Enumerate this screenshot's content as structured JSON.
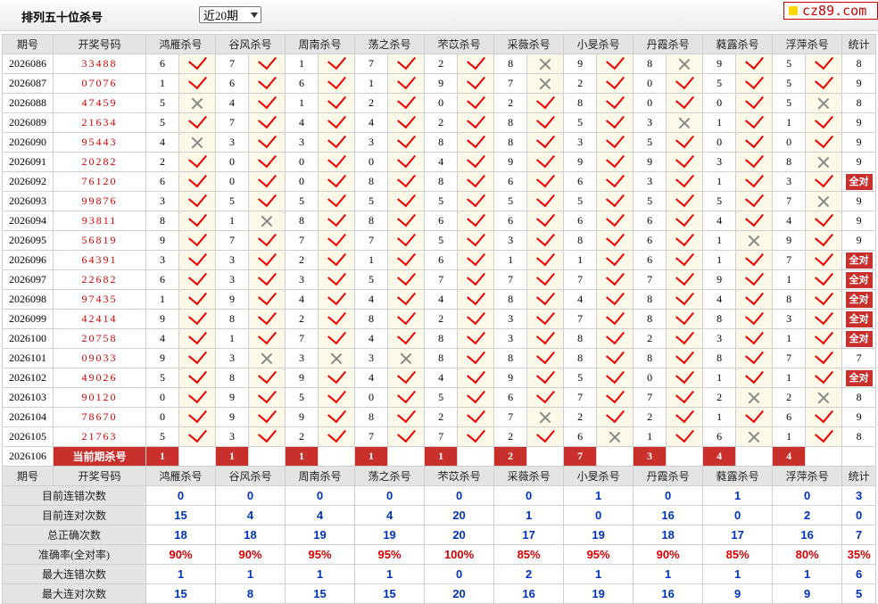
{
  "header": {
    "title": "排列五十位杀号",
    "select_value": "近20期",
    "logo": "cz89.com"
  },
  "table": {
    "columns": [
      "期号",
      "开奖号码",
      "鸿雁杀号",
      "谷风杀号",
      "周南杀号",
      "荡之杀号",
      "芣苡杀号",
      "采薇杀号",
      "小旻杀号",
      "丹霞杀号",
      "蕤露杀号",
      "浮萍杀号",
      "统计"
    ],
    "all_correct_label": "全对",
    "rows": [
      {
        "p": "2026086",
        "d": "33488",
        "k": [
          [
            6,
            1
          ],
          [
            7,
            1
          ],
          [
            1,
            1
          ],
          [
            7,
            1
          ],
          [
            2,
            1
          ],
          [
            8,
            0
          ],
          [
            9,
            1
          ],
          [
            8,
            0
          ],
          [
            9,
            1
          ],
          [
            5,
            1
          ]
        ],
        "s": "8"
      },
      {
        "p": "2026087",
        "d": "07076",
        "k": [
          [
            1,
            1
          ],
          [
            6,
            1
          ],
          [
            6,
            1
          ],
          [
            1,
            1
          ],
          [
            9,
            1
          ],
          [
            7,
            0
          ],
          [
            2,
            1
          ],
          [
            0,
            1
          ],
          [
            5,
            1
          ],
          [
            5,
            1
          ]
        ],
        "s": "9"
      },
      {
        "p": "2026088",
        "d": "47459",
        "k": [
          [
            5,
            0
          ],
          [
            4,
            1
          ],
          [
            1,
            1
          ],
          [
            2,
            1
          ],
          [
            0,
            1
          ],
          [
            2,
            1
          ],
          [
            8,
            1
          ],
          [
            0,
            1
          ],
          [
            0,
            1
          ],
          [
            5,
            0
          ]
        ],
        "s": "8"
      },
      {
        "p": "2026089",
        "d": "21634",
        "k": [
          [
            5,
            1
          ],
          [
            7,
            1
          ],
          [
            4,
            1
          ],
          [
            4,
            1
          ],
          [
            2,
            1
          ],
          [
            8,
            1
          ],
          [
            5,
            1
          ],
          [
            3,
            0
          ],
          [
            1,
            1
          ],
          [
            1,
            1
          ]
        ],
        "s": "9"
      },
      {
        "p": "2026090",
        "d": "95443",
        "k": [
          [
            4,
            0
          ],
          [
            3,
            1
          ],
          [
            3,
            1
          ],
          [
            3,
            1
          ],
          [
            8,
            1
          ],
          [
            8,
            1
          ],
          [
            3,
            1
          ],
          [
            5,
            1
          ],
          [
            0,
            1
          ],
          [
            0,
            1
          ]
        ],
        "s": "9"
      },
      {
        "p": "2026091",
        "d": "20282",
        "k": [
          [
            2,
            1
          ],
          [
            0,
            1
          ],
          [
            0,
            1
          ],
          [
            0,
            1
          ],
          [
            4,
            1
          ],
          [
            9,
            1
          ],
          [
            9,
            1
          ],
          [
            9,
            1
          ],
          [
            3,
            1
          ],
          [
            8,
            0
          ]
        ],
        "s": "9"
      },
      {
        "p": "2026092",
        "d": "76120",
        "k": [
          [
            6,
            1
          ],
          [
            0,
            1
          ],
          [
            0,
            1
          ],
          [
            8,
            1
          ],
          [
            8,
            1
          ],
          [
            6,
            1
          ],
          [
            6,
            1
          ],
          [
            3,
            1
          ],
          [
            1,
            1
          ],
          [
            3,
            1
          ]
        ],
        "s": "全对"
      },
      {
        "p": "2026093",
        "d": "99876",
        "k": [
          [
            3,
            1
          ],
          [
            5,
            1
          ],
          [
            5,
            1
          ],
          [
            5,
            1
          ],
          [
            5,
            1
          ],
          [
            5,
            1
          ],
          [
            5,
            1
          ],
          [
            5,
            1
          ],
          [
            5,
            1
          ],
          [
            7,
            0
          ]
        ],
        "s": "9"
      },
      {
        "p": "2026094",
        "d": "93811",
        "k": [
          [
            8,
            1
          ],
          [
            1,
            0
          ],
          [
            8,
            1
          ],
          [
            8,
            1
          ],
          [
            6,
            1
          ],
          [
            6,
            1
          ],
          [
            6,
            1
          ],
          [
            6,
            1
          ],
          [
            4,
            1
          ],
          [
            4,
            1
          ]
        ],
        "s": "9"
      },
      {
        "p": "2026095",
        "d": "56819",
        "k": [
          [
            9,
            1
          ],
          [
            7,
            1
          ],
          [
            7,
            1
          ],
          [
            7,
            1
          ],
          [
            5,
            1
          ],
          [
            3,
            1
          ],
          [
            8,
            1
          ],
          [
            6,
            1
          ],
          [
            1,
            0
          ],
          [
            9,
            1
          ]
        ],
        "s": "9"
      },
      {
        "p": "2026096",
        "d": "64391",
        "k": [
          [
            3,
            1
          ],
          [
            3,
            1
          ],
          [
            2,
            1
          ],
          [
            1,
            1
          ],
          [
            6,
            1
          ],
          [
            1,
            1
          ],
          [
            1,
            1
          ],
          [
            6,
            1
          ],
          [
            1,
            1
          ],
          [
            7,
            1
          ]
        ],
        "s": "全对"
      },
      {
        "p": "2026097",
        "d": "22682",
        "k": [
          [
            6,
            1
          ],
          [
            3,
            1
          ],
          [
            3,
            1
          ],
          [
            5,
            1
          ],
          [
            7,
            1
          ],
          [
            7,
            1
          ],
          [
            7,
            1
          ],
          [
            7,
            1
          ],
          [
            9,
            1
          ],
          [
            1,
            1
          ]
        ],
        "s": "全对"
      },
      {
        "p": "2026098",
        "d": "97435",
        "k": [
          [
            1,
            1
          ],
          [
            9,
            1
          ],
          [
            4,
            1
          ],
          [
            4,
            1
          ],
          [
            4,
            1
          ],
          [
            8,
            1
          ],
          [
            4,
            1
          ],
          [
            8,
            1
          ],
          [
            4,
            1
          ],
          [
            8,
            1
          ]
        ],
        "s": "全对"
      },
      {
        "p": "2026099",
        "d": "42414",
        "k": [
          [
            9,
            1
          ],
          [
            8,
            1
          ],
          [
            2,
            1
          ],
          [
            8,
            1
          ],
          [
            2,
            1
          ],
          [
            3,
            1
          ],
          [
            7,
            1
          ],
          [
            8,
            1
          ],
          [
            8,
            1
          ],
          [
            3,
            1
          ]
        ],
        "s": "全对"
      },
      {
        "p": "2026100",
        "d": "20758",
        "k": [
          [
            4,
            1
          ],
          [
            1,
            1
          ],
          [
            7,
            1
          ],
          [
            4,
            1
          ],
          [
            8,
            1
          ],
          [
            3,
            1
          ],
          [
            8,
            1
          ],
          [
            2,
            1
          ],
          [
            3,
            1
          ],
          [
            1,
            1
          ]
        ],
        "s": "全对"
      },
      {
        "p": "2026101",
        "d": "09033",
        "k": [
          [
            9,
            1
          ],
          [
            3,
            0
          ],
          [
            3,
            0
          ],
          [
            3,
            0
          ],
          [
            8,
            1
          ],
          [
            8,
            1
          ],
          [
            8,
            1
          ],
          [
            8,
            1
          ],
          [
            8,
            1
          ],
          [
            7,
            1
          ]
        ],
        "s": "7"
      },
      {
        "p": "2026102",
        "d": "49026",
        "k": [
          [
            5,
            1
          ],
          [
            8,
            1
          ],
          [
            9,
            1
          ],
          [
            4,
            1
          ],
          [
            4,
            1
          ],
          [
            9,
            1
          ],
          [
            5,
            1
          ],
          [
            0,
            1
          ],
          [
            1,
            1
          ],
          [
            1,
            1
          ]
        ],
        "s": "全对"
      },
      {
        "p": "2026103",
        "d": "90120",
        "k": [
          [
            0,
            1
          ],
          [
            9,
            1
          ],
          [
            5,
            1
          ],
          [
            0,
            1
          ],
          [
            5,
            1
          ],
          [
            6,
            1
          ],
          [
            7,
            1
          ],
          [
            7,
            1
          ],
          [
            2,
            0
          ],
          [
            2,
            0
          ]
        ],
        "s": "8"
      },
      {
        "p": "2026104",
        "d": "78670",
        "k": [
          [
            0,
            1
          ],
          [
            9,
            1
          ],
          [
            9,
            1
          ],
          [
            8,
            1
          ],
          [
            2,
            1
          ],
          [
            7,
            0
          ],
          [
            2,
            1
          ],
          [
            2,
            1
          ],
          [
            1,
            1
          ],
          [
            6,
            1
          ]
        ],
        "s": "9"
      },
      {
        "p": "2026105",
        "d": "21763",
        "k": [
          [
            5,
            1
          ],
          [
            3,
            1
          ],
          [
            2,
            1
          ],
          [
            7,
            1
          ],
          [
            7,
            1
          ],
          [
            2,
            1
          ],
          [
            6,
            0
          ],
          [
            1,
            1
          ],
          [
            6,
            0
          ],
          [
            1,
            1
          ]
        ],
        "s": "8"
      }
    ],
    "current": {
      "period": "2026106",
      "label": "当前期杀号",
      "values": [
        "1",
        "1",
        "1",
        "1",
        "1",
        "2",
        "7",
        "3",
        "4",
        "4"
      ]
    },
    "stats": [
      {
        "label": "目前连错次数",
        "values": [
          "0",
          "0",
          "0",
          "0",
          "0",
          "0",
          "1",
          "0",
          "1",
          "0",
          "3"
        ]
      },
      {
        "label": "目前连对次数",
        "values": [
          "15",
          "4",
          "4",
          "4",
          "20",
          "1",
          "0",
          "16",
          "0",
          "2",
          "0"
        ]
      },
      {
        "label": "总正确次数",
        "values": [
          "18",
          "18",
          "19",
          "19",
          "20",
          "17",
          "19",
          "18",
          "17",
          "16",
          "7"
        ]
      },
      {
        "label": "准确率(全对率)",
        "values": [
          "90%",
          "90%",
          "95%",
          "95%",
          "100%",
          "85%",
          "95%",
          "90%",
          "85%",
          "80%",
          "35%"
        ],
        "pct": true
      },
      {
        "label": "最大连错次数",
        "values": [
          "1",
          "1",
          "1",
          "1",
          "0",
          "2",
          "1",
          "1",
          "1",
          "1",
          "6"
        ]
      },
      {
        "label": "最大连对次数",
        "values": [
          "15",
          "8",
          "15",
          "15",
          "20",
          "16",
          "19",
          "16",
          "9",
          "9",
          "5"
        ]
      }
    ]
  }
}
